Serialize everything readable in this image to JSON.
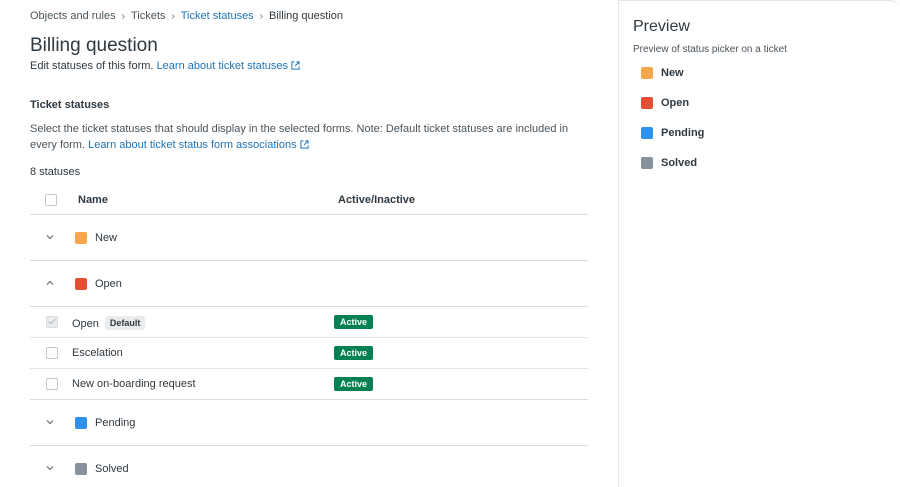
{
  "breadcrumb": {
    "items": [
      "Objects and rules",
      "Tickets",
      "Ticket statuses",
      "Billing question"
    ]
  },
  "page": {
    "title": "Billing question",
    "subtitle_text": "Edit statuses of this form.",
    "subtitle_link": "Learn about ticket statuses"
  },
  "section": {
    "title": "Ticket statuses",
    "description": "Select the ticket statuses that should display in the selected forms. Note: Default ticket statuses are included in every form.",
    "description_link": "Learn about ticket status form associations",
    "count": "8 statuses"
  },
  "table": {
    "col_name": "Name",
    "col_active": "Active/Inactive",
    "groups": [
      {
        "label": "New",
        "color": "#f5a54a",
        "expanded": false
      },
      {
        "label": "Open",
        "color": "#e34f32",
        "expanded": true,
        "rows": [
          {
            "label": "Open",
            "tag": "Default",
            "status": "Active",
            "checked": true,
            "disabled": true
          },
          {
            "label": "Escelation",
            "tag": "",
            "status": "Active",
            "checked": false,
            "disabled": false
          },
          {
            "label": "New on-boarding request",
            "tag": "",
            "status": "Active",
            "checked": false,
            "disabled": false
          }
        ]
      },
      {
        "label": "Pending",
        "color": "#3091ec",
        "expanded": false
      },
      {
        "label": "Solved",
        "color": "#87929d",
        "expanded": false
      }
    ]
  },
  "preview": {
    "title": "Preview",
    "subtitle": "Preview of status picker on a ticket",
    "items": [
      {
        "label": "New",
        "color": "#f5a54a"
      },
      {
        "label": "Open",
        "color": "#e34f32"
      },
      {
        "label": "Pending",
        "color": "#3091ec"
      },
      {
        "label": "Solved",
        "color": "#87929d"
      }
    ]
  }
}
